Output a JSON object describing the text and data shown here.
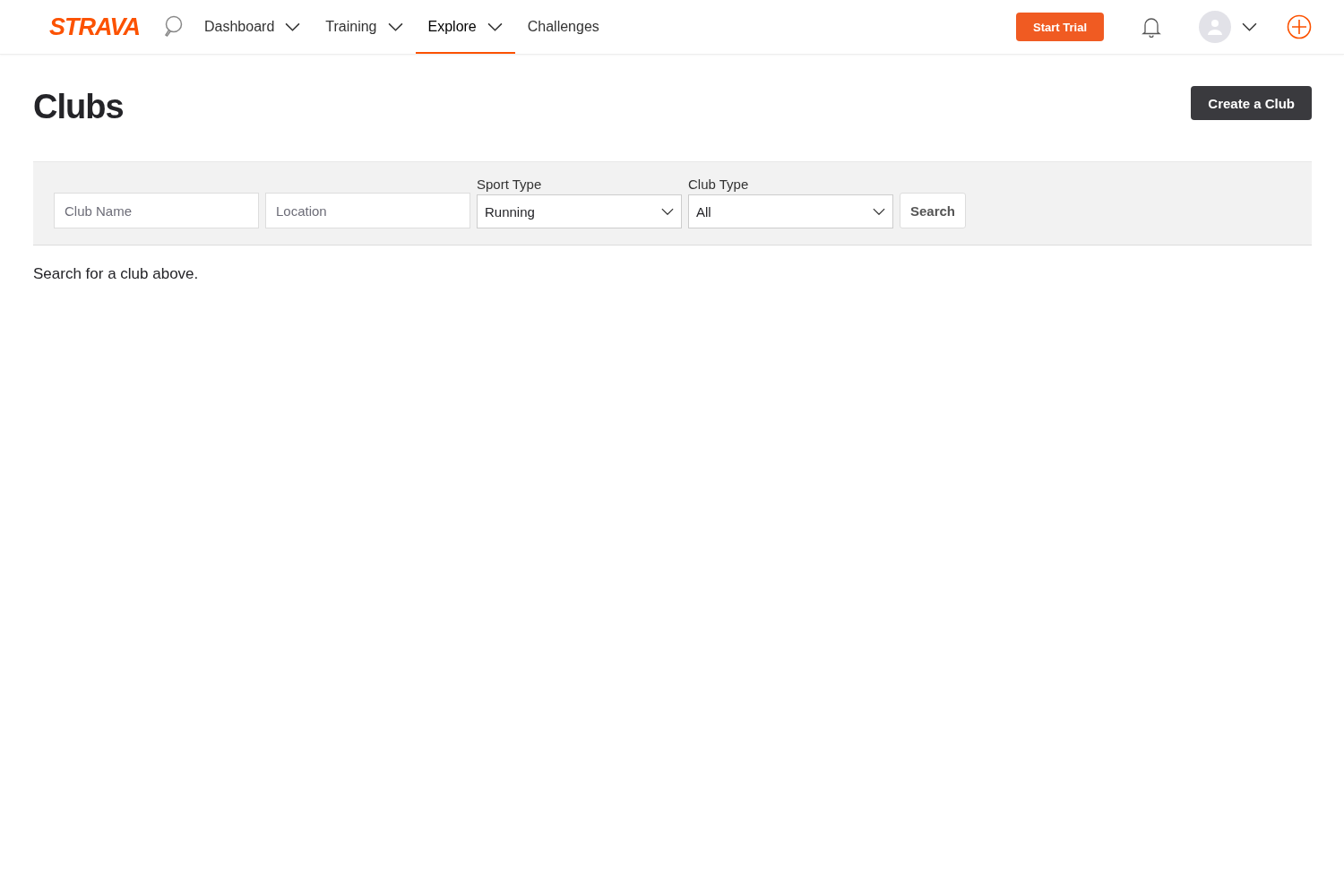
{
  "header": {
    "logo": "STRAVA",
    "nav": [
      {
        "label": "Dashboard",
        "selected": false,
        "dropdown": true
      },
      {
        "label": "Training",
        "selected": false,
        "dropdown": true
      },
      {
        "label": "Explore",
        "selected": true,
        "dropdown": true
      },
      {
        "label": "Challenges",
        "selected": false,
        "dropdown": false
      }
    ],
    "trial_button": "Start Trial"
  },
  "page": {
    "title": "Clubs",
    "create_button": "Create a Club"
  },
  "filters": {
    "club_name": {
      "placeholder": "Club Name"
    },
    "location": {
      "placeholder": "Location"
    },
    "sport_type": {
      "label": "Sport Type",
      "value": "Running"
    },
    "club_type": {
      "label": "Club Type",
      "value": "All"
    },
    "search_button": "Search"
  },
  "message": "Search for a club above."
}
